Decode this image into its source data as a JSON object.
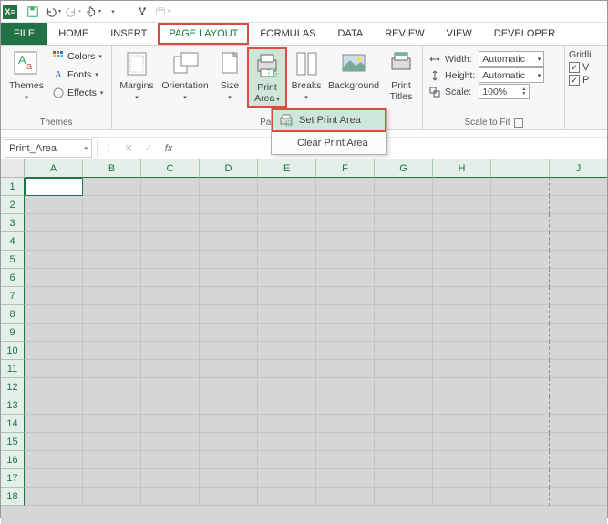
{
  "qat": {
    "save": "💾"
  },
  "tabs": {
    "file": "FILE",
    "home": "HOME",
    "insert": "INSERT",
    "pagelayout": "PAGE LAYOUT",
    "formulas": "FORMULAS",
    "data": "DATA",
    "review": "REVIEW",
    "view": "VIEW",
    "developer": "DEVELOPER"
  },
  "ribbon": {
    "themes": {
      "label": "Themes",
      "btn": "Themes",
      "colors": "Colors",
      "fonts": "Fonts",
      "effects": "Effects"
    },
    "pagesetup": {
      "label": "Pag",
      "margins": "Margins",
      "orientation": "Orientation",
      "size": "Size",
      "printarea": "Print",
      "printarea2": "Area",
      "breaks": "Breaks",
      "background": "Background",
      "printtitles": "Print",
      "printtitles2": "Titles"
    },
    "scale": {
      "label": "Scale to Fit",
      "width": "Width:",
      "height": "Height:",
      "scale": "Scale:",
      "auto": "Automatic",
      "pct": "100%"
    },
    "sheet": {
      "gridlines": "Gridli",
      "view": "V",
      "print": "P"
    }
  },
  "dropdown": {
    "set": "Set Print Area",
    "clear": "Clear Print Area"
  },
  "namebox": "Print_Area",
  "columns": [
    "A",
    "B",
    "C",
    "D",
    "E",
    "F",
    "G",
    "H",
    "I",
    "J"
  ],
  "rows": [
    "1",
    "2",
    "3",
    "4",
    "5",
    "6",
    "7",
    "8",
    "9",
    "10",
    "11",
    "12",
    "13",
    "14",
    "15",
    "16",
    "17",
    "18"
  ]
}
